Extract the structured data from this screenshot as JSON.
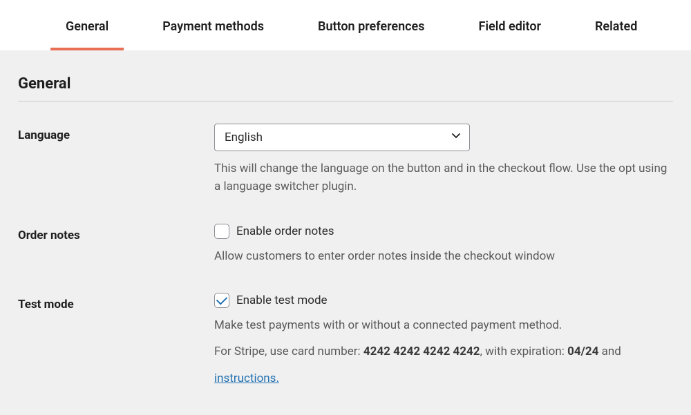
{
  "tabs": [
    {
      "label": "General",
      "active": true
    },
    {
      "label": "Payment methods",
      "active": false
    },
    {
      "label": "Button preferences",
      "active": false
    },
    {
      "label": "Field editor",
      "active": false
    },
    {
      "label": "Related",
      "active": false
    }
  ],
  "section_title": "General",
  "language": {
    "label": "Language",
    "value": "English",
    "help": "This will change the language on the button and in the checkout flow. Use the opt using a language switcher plugin."
  },
  "order_notes": {
    "label": "Order notes",
    "checkbox_label": "Enable order notes",
    "checked": false,
    "help": "Allow customers to enter order notes inside the checkout window"
  },
  "test_mode": {
    "label": "Test mode",
    "checkbox_label": "Enable test mode",
    "checked": true,
    "help": "Make test payments with or without a connected payment method.",
    "stripe_prefix": "For Stripe, use card number: ",
    "stripe_card": "4242 4242 4242 4242",
    "stripe_mid": ",  with expiration: ",
    "stripe_exp": "04/24",
    "stripe_suffix": " and",
    "instructions_label": "instructions."
  }
}
